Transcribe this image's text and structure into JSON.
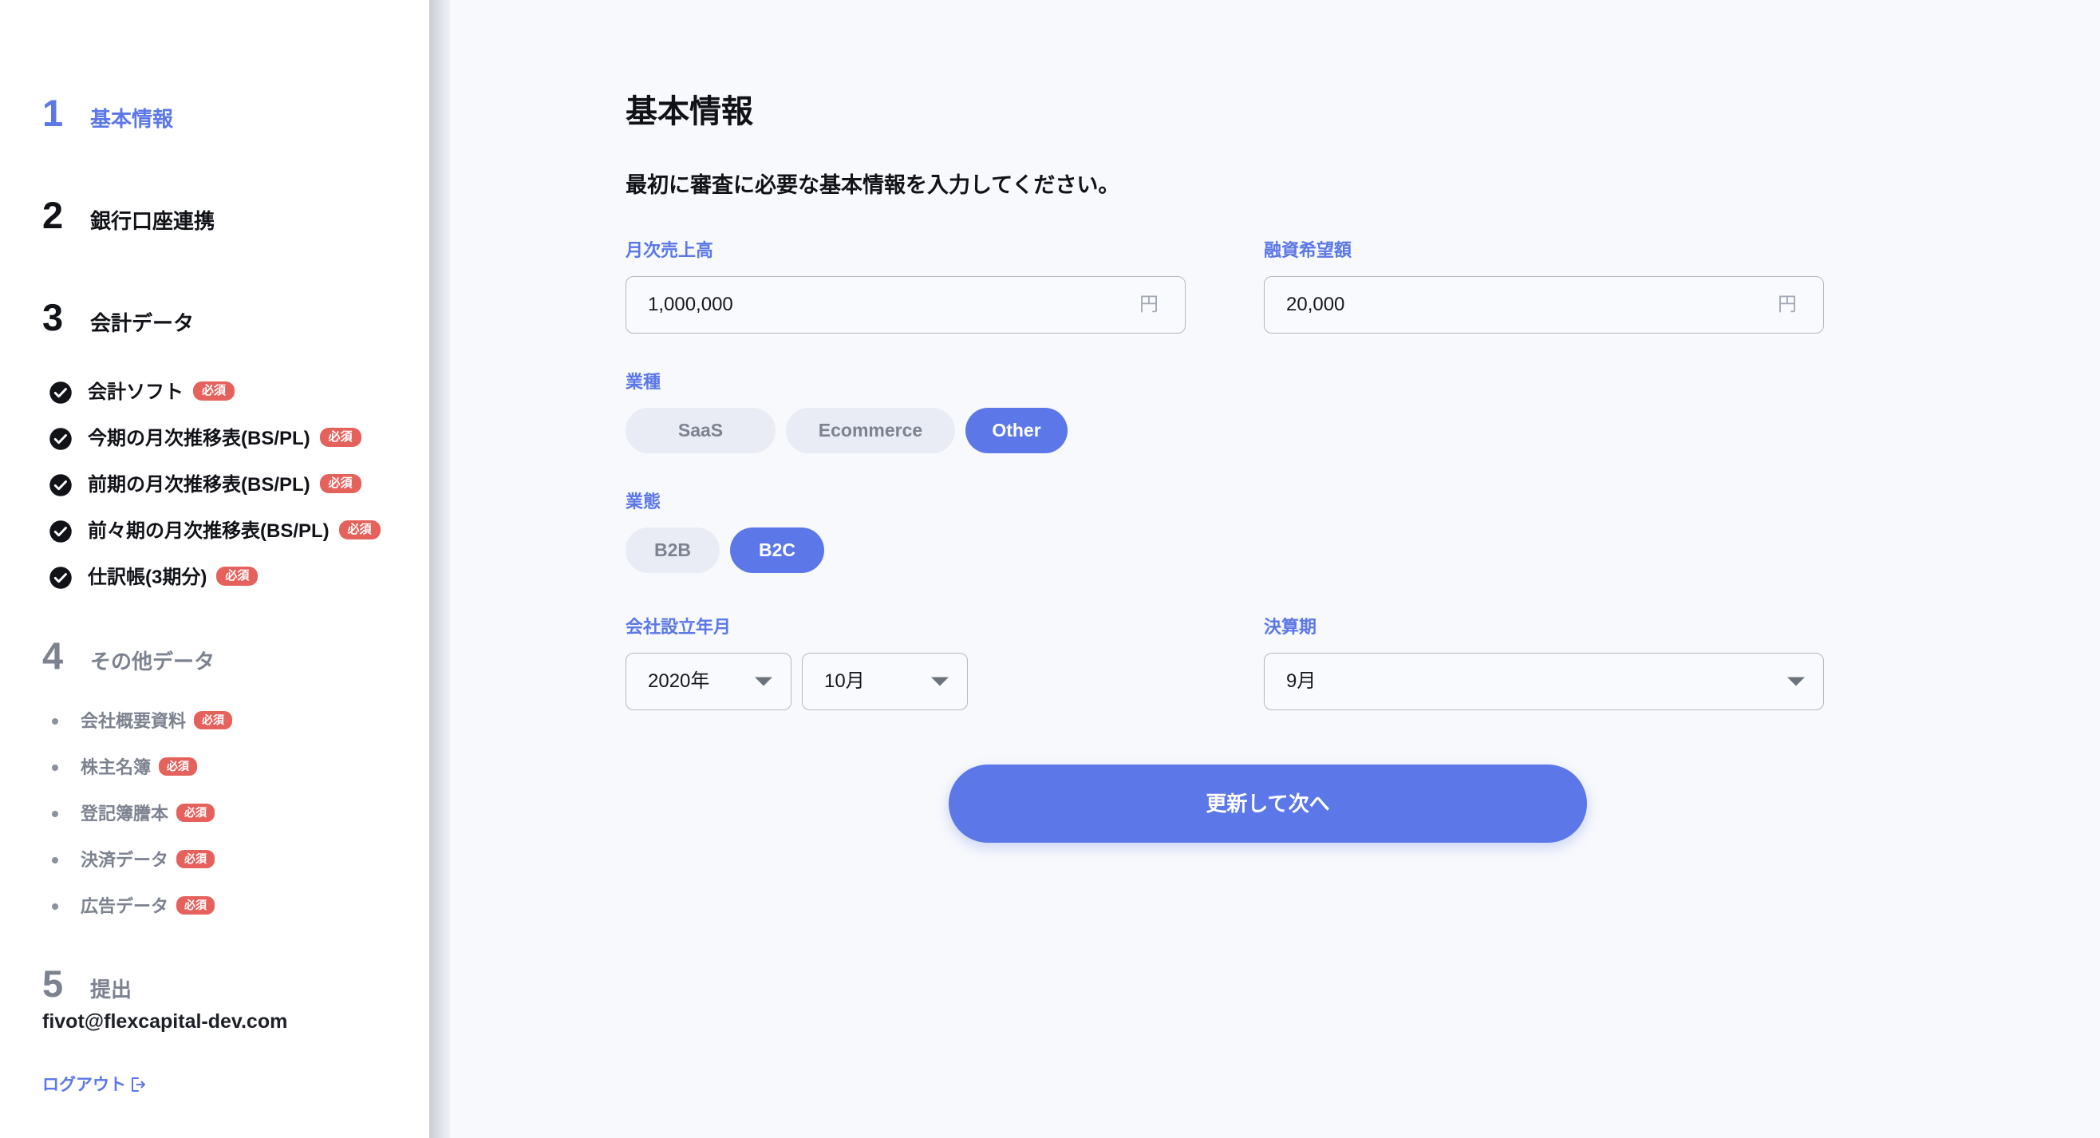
{
  "sidebar": {
    "steps": [
      {
        "num": "1",
        "label": "基本情報",
        "state": "active"
      },
      {
        "num": "2",
        "label": "銀行口座連携",
        "state": "default"
      },
      {
        "num": "3",
        "label": "会計データ",
        "state": "default"
      },
      {
        "num": "4",
        "label": "その他データ",
        "state": "muted"
      },
      {
        "num": "5",
        "label": "提出",
        "state": "muted"
      }
    ],
    "accounting_items": [
      {
        "label": "会計ソフト",
        "badge": "必須",
        "icon": "check-circle-icon"
      },
      {
        "label": "今期の月次推移表(BS/PL)",
        "badge": "必須",
        "icon": "check-circle-icon"
      },
      {
        "label": "前期の月次推移表(BS/PL)",
        "badge": "必須",
        "icon": "check-circle-icon"
      },
      {
        "label": "前々期の月次推移表(BS/PL)",
        "badge": "必須",
        "icon": "check-circle-icon"
      },
      {
        "label": "仕訳帳(3期分)",
        "badge": "必須",
        "icon": "check-circle-icon"
      }
    ],
    "other_items": [
      {
        "label": "会社概要資料",
        "badge": "必須"
      },
      {
        "label": "株主名簿",
        "badge": "必須"
      },
      {
        "label": "登記簿謄本",
        "badge": "必須"
      },
      {
        "label": "決済データ",
        "badge": "必須"
      },
      {
        "label": "広告データ",
        "badge": "必須"
      }
    ],
    "user_email": "fivot@flexcapital-dev.com",
    "logout_label": "ログアウト",
    "logout_icon": "sign-out-icon"
  },
  "main": {
    "title": "基本情報",
    "subtitle": "最初に審査に必要な基本情報を入力してください。",
    "monthly_revenue": {
      "label": "月次売上高",
      "value": "1,000,000",
      "placeholder": "",
      "suffix": "円"
    },
    "loan_amount": {
      "label": "融資希望額",
      "value": "20,000",
      "placeholder": "",
      "suffix": "円"
    },
    "industry": {
      "label": "業種",
      "options": [
        "SaaS",
        "Ecommerce",
        "Other"
      ],
      "selected": "Other"
    },
    "business_model": {
      "label": "業態",
      "options": [
        "B2B",
        "B2C"
      ],
      "selected": "B2C"
    },
    "founded": {
      "label": "会社設立年月",
      "year_value": "2020年",
      "month_value": "10月"
    },
    "fiscal_year_end": {
      "label": "決算期",
      "value": "9月"
    },
    "submit_label": "更新して次へ"
  },
  "colors": {
    "accent_blue": "#5b77e8",
    "badge_red": "#e5615c",
    "muted_gray": "#7c828f",
    "page_bg": "#f7f9fc",
    "sidebar_bg": "#ffffff"
  }
}
